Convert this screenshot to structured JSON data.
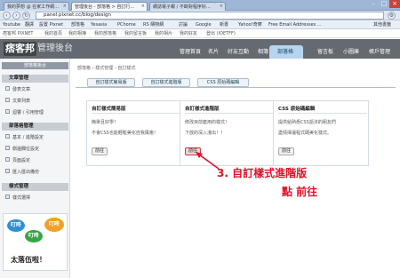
{
  "browser": {
    "tabs": [
      {
        "label": "我的夢想 @ 在家工作網…",
        "active": false
      },
      {
        "label": "管理後台 - 部落格 > 自訂行…",
        "active": true
      },
      {
        "label": "網誌電子報 / 不斷對程序好…",
        "active": false
      }
    ],
    "url": "panel.pixnet.cc/blog/design",
    "bookmarks": [
      "Youtube",
      "翻譯",
      "設置 Pixnet",
      "部落格",
      "Yesasia",
      "PChome",
      "RS 購物網",
      "討論",
      "Google",
      "新書",
      "Yahoo!奇摩",
      "Free Email Addresses ...",
      "其他書籤"
    ]
  },
  "pixnet_topbar": [
    "痞客邦 PIXNET",
    "我的首頁",
    "我的相簿",
    "我的部落格",
    "我的留言板",
    "我的相片",
    "我的好友",
    "登出 (IOETFF)"
  ],
  "header": {
    "logo": "痞客邦",
    "subtitle": "管理後台",
    "nav": [
      "管理首頁",
      "名片",
      "好友互動",
      "相簿",
      "部落格",
      "留言板",
      "小圖庫",
      "帳戶管理"
    ],
    "active_nav": "部落格"
  },
  "sidebar": {
    "title": "部落格後台",
    "sections": [
      {
        "heading": "文章管理",
        "items": [
          "發表文章",
          "文章列表",
          "迴響 / 引用管理"
        ]
      },
      {
        "heading": "部落格管理",
        "items": [
          "基本 / 進階設定",
          "側邊欄位設定",
          "頁面設定",
          "匯入匯出備份"
        ]
      },
      {
        "heading": "樣式管理",
        "items": [
          "樣式選擇"
        ]
      }
    ],
    "ad": {
      "bubbles": [
        "叮咚",
        "叮咚",
        "叮咚"
      ],
      "text": "太落伍啦！"
    }
  },
  "breadcrumb": [
    "部落格",
    "樣式管理",
    "自訂樣式"
  ],
  "subtabs": [
    "自訂樣式簡易版",
    "自訂樣式進階版",
    "CSS 原始碼編輯"
  ],
  "cards": [
    {
      "title": "自訂樣式簡易版",
      "lines": [
        "簡單且好學！",
        "不會CSS也能輕鬆美化自我風格！"
      ],
      "button": "前往"
    },
    {
      "title": "自訂樣式進階版",
      "lines": [
        "修改目前套用的樣式！",
        "下放的深入淺出！！"
      ],
      "button": "前往"
    },
    {
      "title": "CSS 原始碼編輯",
      "lines": [
        "提供給熟悉CSS語法的朋友們",
        "盡情揮灑程式碼美化樣式。"
      ],
      "button": "前往"
    }
  ],
  "annotation": {
    "step": "3. 自訂樣式進階版",
    "action": "點 前往"
  },
  "colors": {
    "header_bg": "#646a70",
    "active_nav": "#b7d4ee",
    "annotation": "#e0102a"
  }
}
